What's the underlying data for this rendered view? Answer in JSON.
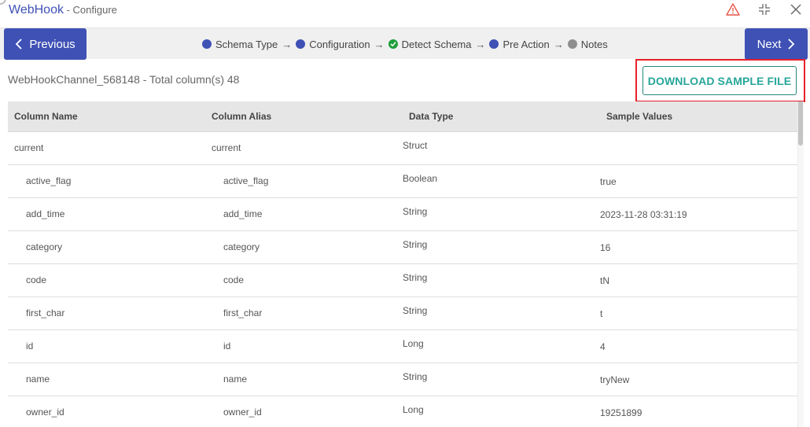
{
  "window": {
    "title": "WebHook",
    "subtitle": " - Configure",
    "icons": [
      "warning-icon",
      "minimize-icon",
      "close-icon"
    ]
  },
  "nav": {
    "previous_label": "Previous",
    "next_label": "Next"
  },
  "steps": [
    {
      "label": "Schema Type",
      "status": "active",
      "color": "#3f51b5"
    },
    {
      "label": "Configuration",
      "status": "active",
      "color": "#3f51b5"
    },
    {
      "label": "Detect Schema",
      "status": "completed",
      "color": "#1e9e3a"
    },
    {
      "label": "Pre Action",
      "status": "active",
      "color": "#3f51b5"
    },
    {
      "label": "Notes",
      "status": "pending",
      "color": "#8e8e8e"
    }
  ],
  "step_separator": "→",
  "summary": "WebHookChannel_568148 - Total column(s) 48",
  "download_button_label": "DOWNLOAD SAMPLE FILE",
  "colors": {
    "primary": "#3f51b5",
    "accent_teal": "#26a69a",
    "highlight_red": "#e5212b",
    "success_green": "#1e9e3a",
    "warning_icon": "#e8574a"
  },
  "table": {
    "headers": [
      "Column Name",
      "Column Alias",
      "Data Type",
      "Sample Values"
    ],
    "rows": [
      {
        "name": "current",
        "alias": "current",
        "type": "Struct",
        "sample": "",
        "nested": false
      },
      {
        "name": "active_flag",
        "alias": "active_flag",
        "type": "Boolean",
        "sample": "true",
        "nested": true
      },
      {
        "name": "add_time",
        "alias": "add_time",
        "type": "String",
        "sample": "2023-11-28 03:31:19",
        "nested": true
      },
      {
        "name": "category",
        "alias": "category",
        "type": "String",
        "sample": "16",
        "nested": true
      },
      {
        "name": "code",
        "alias": "code",
        "type": "String",
        "sample": "tN",
        "nested": true
      },
      {
        "name": "first_char",
        "alias": "first_char",
        "type": "String",
        "sample": "t",
        "nested": true
      },
      {
        "name": "id",
        "alias": "id",
        "type": "Long",
        "sample": "4",
        "nested": true
      },
      {
        "name": "name",
        "alias": "name",
        "type": "String",
        "sample": "tryNew",
        "nested": true
      },
      {
        "name": "owner_id",
        "alias": "owner_id",
        "type": "Long",
        "sample": "19251899",
        "nested": true
      }
    ]
  }
}
